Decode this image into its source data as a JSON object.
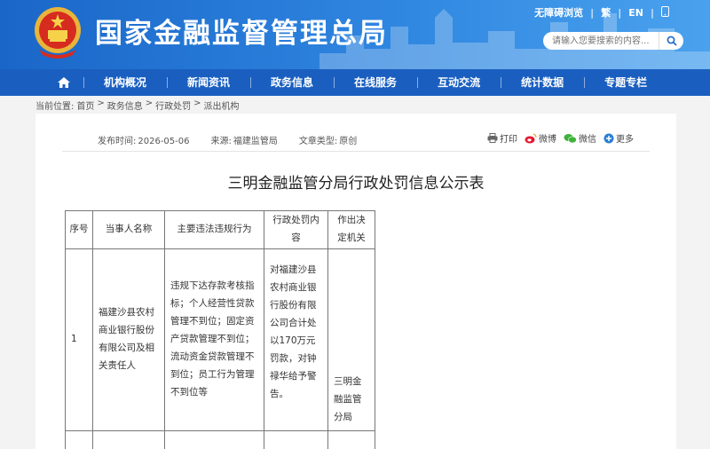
{
  "header": {
    "site_title": "国家金融监督管理总局",
    "top_links": [
      "无障碍浏览",
      "繁",
      "EN"
    ],
    "search_placeholder": "请输入您要搜索的内容..."
  },
  "nav": {
    "items": [
      "机构概况",
      "新闻资讯",
      "政务信息",
      "在线服务",
      "互动交流",
      "统计数据",
      "专题专栏"
    ]
  },
  "breadcrumb": {
    "label": "当前位置:",
    "items": [
      "首页",
      "政务信息",
      "行政处罚",
      "派出机构"
    ],
    "separator": ">"
  },
  "meta": {
    "publish_label": "发布时间:",
    "publish_date": "2026-05-06",
    "source_label": "来源:",
    "source": "福建监管局",
    "type_label": "文章类型:",
    "type": "原创"
  },
  "share": {
    "print": "打印",
    "weibo": "微博",
    "wechat": "微信",
    "more": "更多"
  },
  "doc_title": "三明金融监管分局行政处罚信息公示表",
  "table": {
    "headers": [
      "序号",
      "当事人名称",
      "主要违法违规行为",
      "行政处罚内容",
      "作出决定机关"
    ],
    "rows": [
      {
        "no": "1",
        "party": "福建沙县农村商业银行股份有限公司及相关责任人",
        "violation": "违规下达存款考核指标；个人经营性贷款管理不到位；固定资产贷款管理不到位；流动资金贷款管理不到位；员工行为管理不到位等",
        "penalty": "对福建沙县农村商业银行股份有限公司合计处以170万元罚款，对钟禄华给予警告。",
        "authority": "三明金融监管分局"
      }
    ]
  },
  "colors": {
    "header_blue": "#1a66c8",
    "nav_blue": "#1a5fc0"
  }
}
